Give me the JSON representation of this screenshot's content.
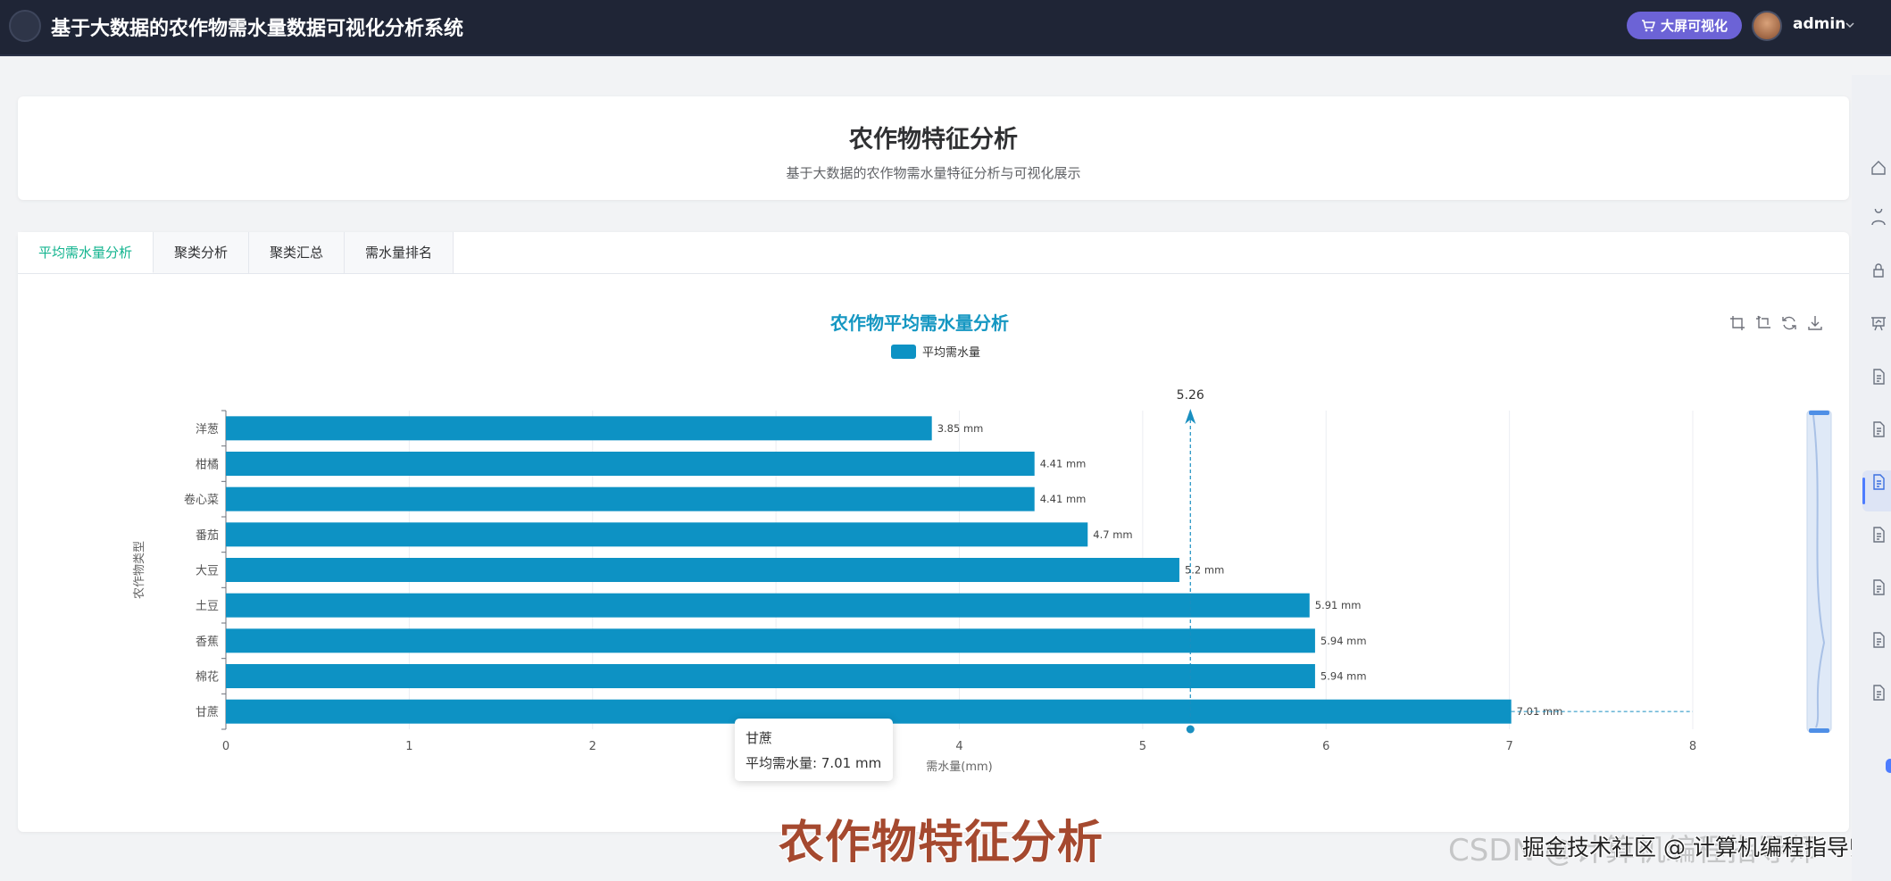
{
  "app": {
    "title": "基于大数据的农作物需水量数据可视化分析系统",
    "bigscreen_label": "大屏可视化",
    "username": "admin"
  },
  "header": {
    "title": "农作物特征分析",
    "subtitle": "基于大数据的农作物需水量特征分析与可视化展示"
  },
  "tabs": [
    {
      "label": "平均需水量分析",
      "active": true
    },
    {
      "label": "聚类分析",
      "active": false
    },
    {
      "label": "聚类汇总",
      "active": false
    },
    {
      "label": "需水量排名",
      "active": false
    }
  ],
  "toolbox": {
    "icons": [
      "zoom-icon",
      "zoom-reset-icon",
      "restore-icon",
      "save-image-icon"
    ]
  },
  "chart_data": {
    "type": "bar",
    "orientation": "horizontal",
    "title": "农作物平均需水量分析",
    "legend": [
      "平均需水量"
    ],
    "legend_position": "top-center",
    "categories": [
      "洋葱",
      "柑橘",
      "卷心菜",
      "番茄",
      "大豆",
      "土豆",
      "香蕉",
      "棉花",
      "甘蔗"
    ],
    "series": [
      {
        "name": "平均需水量",
        "values": [
          3.85,
          4.41,
          4.41,
          4.7,
          5.2,
          5.91,
          5.94,
          5.94,
          7.01
        ],
        "labels": [
          "3.85 mm",
          "4.41 mm",
          "4.41 mm",
          "4.7 mm",
          "5.2 mm",
          "5.91 mm",
          "5.94 mm",
          "5.94 mm",
          "7.01 mm"
        ],
        "color": "#0d92c4"
      }
    ],
    "xlabel": "需水量(mm)",
    "ylabel": "农作物类型",
    "xlim": [
      0,
      8
    ],
    "xticks": [
      "0",
      "1",
      "2",
      "3",
      "4",
      "5",
      "6",
      "7",
      "8"
    ],
    "grid": true,
    "mark_line": {
      "value": 5.26,
      "label": "5.26"
    },
    "tooltip": {
      "title": "甘蔗",
      "line": "平均需水量: 7.01 mm"
    }
  },
  "overlay": {
    "watermark": "农作物特征分析",
    "credit_bg": "CSDN @计算机编程指导师",
    "credit_fg": "掘金技术社区 @ 计算机编程指导师"
  },
  "colors": {
    "topbar": "#1f2536",
    "accent_tab": "#13b48f",
    "chart_title": "#1597c2",
    "bar": "#0d92c4",
    "bigscreen_button": "#6c63d6"
  },
  "right_rail": {
    "icons": [
      "home-icon",
      "user-icon",
      "lock-icon",
      "presentation-icon",
      "document-icon",
      "document-icon",
      "document-icon",
      "document-icon",
      "document-icon",
      "document-icon",
      "document-icon"
    ]
  }
}
